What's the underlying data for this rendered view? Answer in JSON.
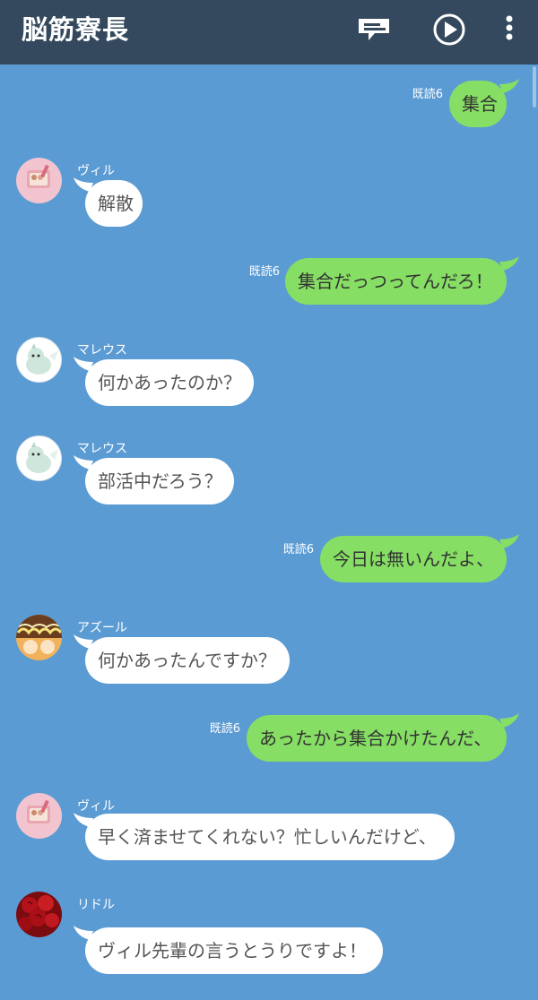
{
  "header": {
    "title": "脳筋寮長",
    "icons": [
      "notes-icon",
      "play-icon",
      "more-icon"
    ],
    "background": "#34495e"
  },
  "theme": {
    "chat_background": "#5b9bd3",
    "outgoing_bubble": "#86de64",
    "incoming_bubble": "#ffffff"
  },
  "messages": [
    {
      "side": "out",
      "read": "既読6",
      "text": "集合"
    },
    {
      "side": "in",
      "sender": "ヴィル",
      "text": "解散"
    },
    {
      "side": "out",
      "read": "既読6",
      "text": "集合だっつってんだろ！"
    },
    {
      "side": "in",
      "sender": "マレウス",
      "text": "何かあったのか？"
    },
    {
      "side": "in",
      "sender": "マレウス",
      "text": "部活中だろう？"
    },
    {
      "side": "out",
      "read": "既読6",
      "text": "今日は無いんだよ、"
    },
    {
      "side": "in",
      "sender": "アズール",
      "text": "何かあったんですか？"
    },
    {
      "side": "out",
      "read": "既読6",
      "text": "あったから集合かけたんだ、"
    },
    {
      "side": "in",
      "sender": "ヴィル",
      "text": "早く済ませてくれない？忙しいんだけど、"
    },
    {
      "side": "in",
      "sender": "リドル",
      "text": "ヴィル先輩の言うとうりですよ！"
    }
  ]
}
